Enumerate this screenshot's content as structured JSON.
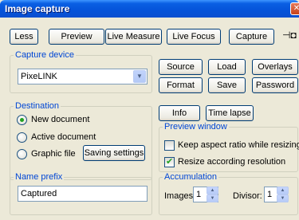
{
  "window": {
    "title": "Image capture",
    "close_icon": "close-icon"
  },
  "toolbar": {
    "less": "Less",
    "preview": "Preview",
    "live_measure": "Live Measure",
    "live_focus": "Live Focus",
    "capture": "Capture",
    "pin_icon": "pin-icon"
  },
  "capture_device": {
    "legend": "Capture device",
    "selected": "PixeLINK"
  },
  "device_buttons": {
    "source": "Source",
    "load": "Load",
    "overlays": "Overlays",
    "format": "Format",
    "save": "Save",
    "password": "Password"
  },
  "destination": {
    "legend": "Destination",
    "options": [
      "New document",
      "Active document",
      "Graphic file"
    ],
    "selected_index": 0,
    "saving_settings": "Saving settings"
  },
  "info_buttons": {
    "info": "Info",
    "time_lapse": "Time lapse"
  },
  "preview_window": {
    "legend": "Preview window",
    "keep_aspect": {
      "label": "Keep aspect ratio while resizing",
      "checked": false
    },
    "resize_resolution": {
      "label": "Resize according resolution",
      "checked": true
    }
  },
  "name_prefix": {
    "legend": "Name prefix",
    "value": "Captured"
  },
  "accumulation": {
    "legend": "Accumulation",
    "images_label": "Images:",
    "images_value": "1",
    "divisor_label": "Divisor:",
    "divisor_value": "1"
  }
}
